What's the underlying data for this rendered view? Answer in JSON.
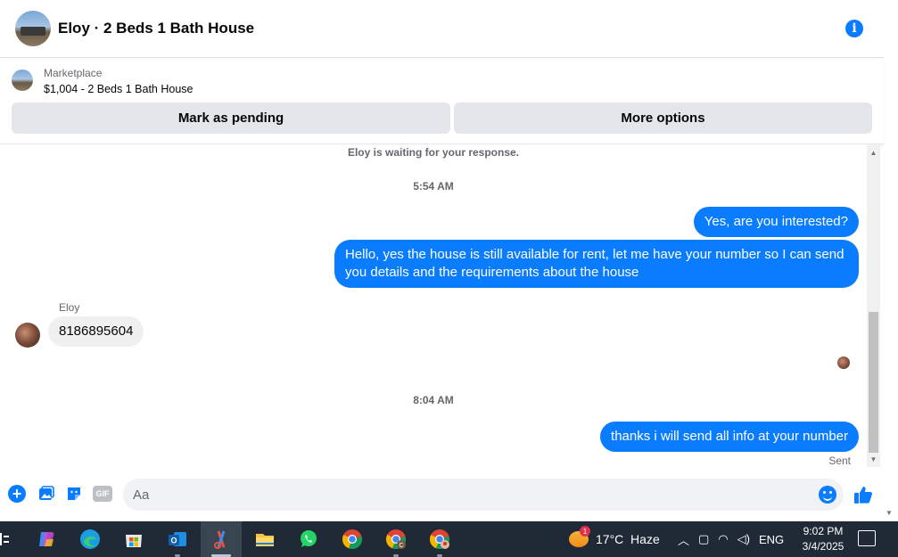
{
  "header": {
    "title": "Eloy · 2 Beds 1 Bath House",
    "avatar": "house-photo",
    "info_icon": "info-icon"
  },
  "listing": {
    "category": "Marketplace",
    "details": "$1,004 - 2 Beds 1 Bath House",
    "mark_pending_label": "Mark as pending",
    "more_options_label": "More options"
  },
  "messages": {
    "notice": "Eloy is waiting for your response.",
    "time1": "5:54 AM",
    "out1": "Yes, are you interested?",
    "out2": "Hello, yes the house is still available for rent, let me have your number so I can send you details and the requirements about the house",
    "sender": "Eloy",
    "in1": "8186895604",
    "time2": "8:04 AM",
    "out3": "thanks i will send all info at your number",
    "status": "Sent"
  },
  "composer": {
    "placeholder": "Aa",
    "gif_label": "GIF",
    "icons": [
      "plus-icon",
      "photo-icon",
      "sticker-icon",
      "gif-icon",
      "emoji-icon",
      "like-icon"
    ]
  },
  "taskbar": {
    "apps": [
      "copilot",
      "edge",
      "microsoft-store",
      "outlook",
      "snipping-tool",
      "file-explorer",
      "whatsapp",
      "chrome",
      "chrome-profile-c",
      "chrome-profile-2"
    ],
    "weather_badge": "1",
    "weather": "17°C  Haze",
    "language": "ENG",
    "time": "9:02 PM",
    "date": "3/4/2025"
  },
  "colors": {
    "accent": "#0a7cff",
    "bubble_in": "#f0f0f0",
    "taskbar": "#1f2a36"
  }
}
